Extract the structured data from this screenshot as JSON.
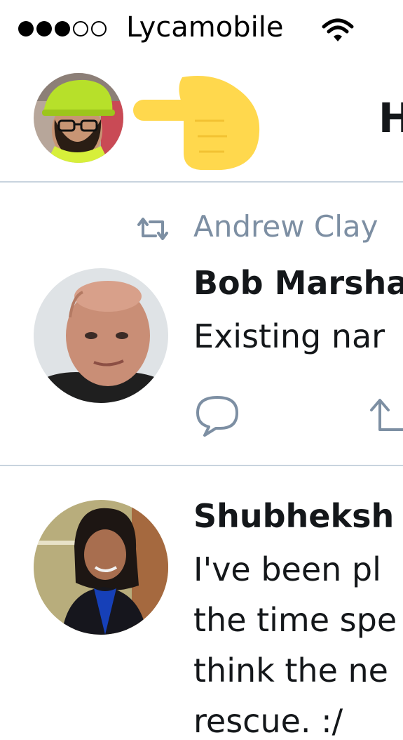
{
  "status_bar": {
    "signal_bars_filled": 3,
    "signal_bars_total": 5,
    "carrier": "Lycamobile",
    "wifi_icon": "wifi-icon"
  },
  "header": {
    "title": "H",
    "profile_avatar_icon": "profile-avatar",
    "annotation_icon": "pointing-hand-icon"
  },
  "timeline": {
    "tweets": [
      {
        "retweet_context": "Andrew Clay",
        "author": "Bob Marsha",
        "text_lines": [
          "Existing nar"
        ],
        "actions": [
          "reply-icon",
          "retweet-icon"
        ]
      },
      {
        "author": "Shubheksh",
        "text_lines": [
          "I've been pl",
          "the time spe",
          "think the ne",
          "rescue. :/"
        ]
      }
    ]
  },
  "colors": {
    "accent_gray": "#7d8fa3",
    "divider": "#c8d3de",
    "hand_yellow": "#ffd84d",
    "text": "#14171a"
  }
}
